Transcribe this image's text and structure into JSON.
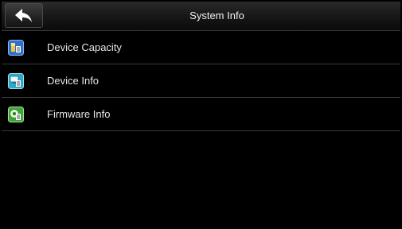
{
  "header": {
    "title": "System Info",
    "back_icon": "back-arrow-icon"
  },
  "menu": {
    "items": [
      {
        "label": "Device Capacity",
        "icon": "device-capacity-icon",
        "color": "#2f6fd0"
      },
      {
        "label": "Device Info",
        "icon": "device-info-icon",
        "color": "#2aa9c9"
      },
      {
        "label": "Firmware Info",
        "icon": "firmware-info-icon",
        "color": "#3fa63a"
      }
    ]
  }
}
